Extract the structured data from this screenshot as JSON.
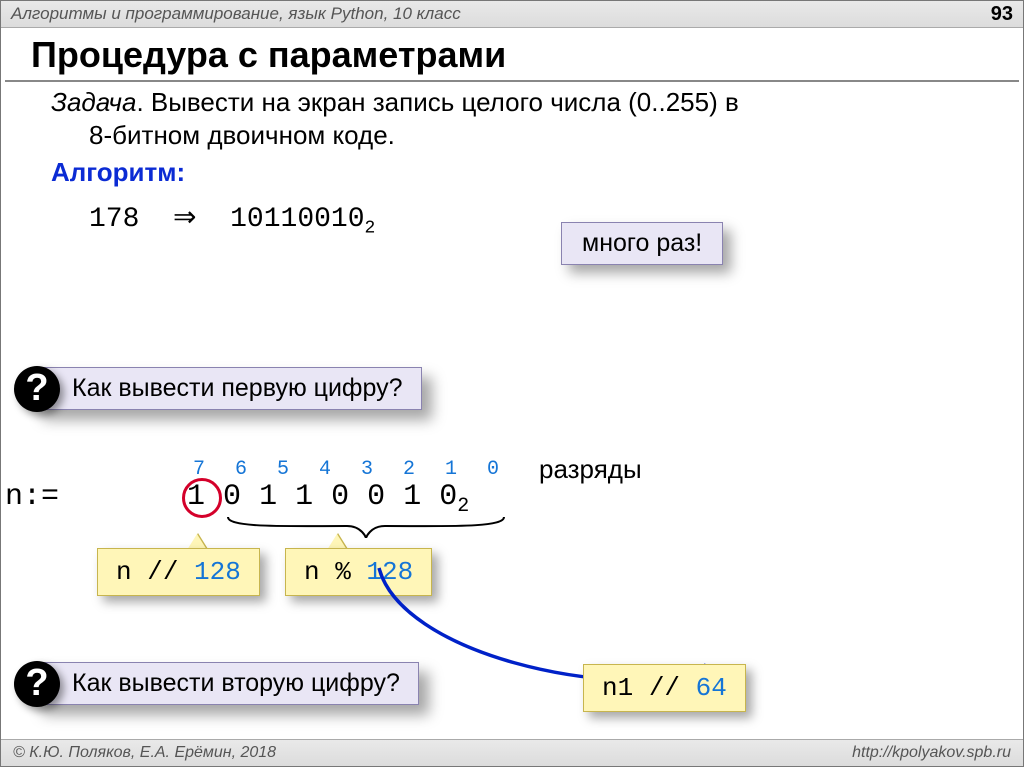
{
  "header": {
    "course": "Алгоритмы и программирование, язык Python, 10 класс",
    "page": "93"
  },
  "title": "Процедура с параметрами",
  "task": {
    "label": "Задача",
    "line1": ". Вывести на экран запись целого числа (0..255) в",
    "line2": "8-битном двоичном коде."
  },
  "note_repeat": "много раз!",
  "algo_label": "Алгоритм:",
  "example": {
    "dec": "178",
    "arrow": "⇒",
    "bin": "10110010",
    "base": "2"
  },
  "q1": "Как вывести первую цифру?",
  "bits": {
    "indices": [
      "7",
      "6",
      "5",
      "4",
      "3",
      "2",
      "1",
      "0"
    ],
    "label": "разряды",
    "prefix": "n:=",
    "digits": [
      "1",
      "0",
      "1",
      "1",
      "0",
      "0",
      "1",
      "0"
    ],
    "base": "2"
  },
  "code1": {
    "var": "n",
    "op": " // ",
    "val": "128"
  },
  "code2": {
    "var": "n",
    "op": " % ",
    "val": "128"
  },
  "q2": "Как вывести вторую цифру?",
  "code3": {
    "var": "n1",
    "op": " // ",
    "val": "64"
  },
  "footer": {
    "left": "© К.Ю. Поляков, Е.А. Ерёмин, 2018",
    "right": "http://kpolyakov.spb.ru"
  }
}
